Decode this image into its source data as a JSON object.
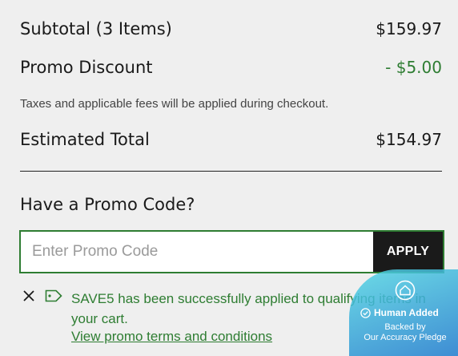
{
  "summary": {
    "subtotal_label": "Subtotal (3 Items)",
    "subtotal_value": "$159.97",
    "promo_label": "Promo Discount",
    "promo_value": "- $5.00",
    "tax_note": "Taxes and applicable fees will be applied during checkout.",
    "total_label": "Estimated Total",
    "total_value": "$154.97"
  },
  "promo": {
    "heading": "Have a Promo Code?",
    "placeholder": "Enter Promo Code",
    "apply_label": "APPLY",
    "success_message": "SAVE5 has been successfully applied to qualifying items in your cart.",
    "terms_link": "View promo terms and conditions"
  },
  "badge": {
    "line1": "Human Added",
    "line2": "Backed by",
    "line3": "Our Accuracy Pledge"
  },
  "colors": {
    "accent_green": "#2e7d32",
    "button_dark": "#1a1a1a",
    "badge_gradient": [
      "#4fd7e4",
      "#2b82d0"
    ]
  },
  "icons": [
    "close-icon",
    "tag-icon",
    "badge-logo-icon",
    "check-circle-icon"
  ]
}
